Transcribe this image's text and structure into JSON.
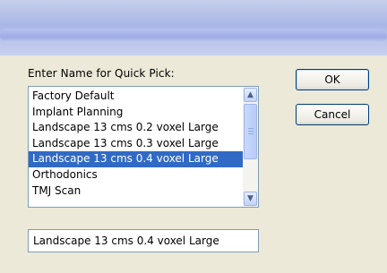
{
  "dialog": {
    "prompt": "Enter Name for Quick Pick:"
  },
  "list": {
    "items": [
      {
        "label": "Factory Default",
        "selected": false
      },
      {
        "label": "Implant Planning",
        "selected": false
      },
      {
        "label": "Landscape 13 cms 0.2 voxel Large",
        "selected": false
      },
      {
        "label": "Landscape 13 cms 0.3 voxel Large",
        "selected": false
      },
      {
        "label": "Landscape 13 cms 0.4 voxel Large",
        "selected": true
      },
      {
        "label": "Orthodonics",
        "selected": false
      },
      {
        "label": "TMJ Scan",
        "selected": false
      }
    ]
  },
  "name_field": {
    "value": "Landscape 13 cms 0.4 voxel Large"
  },
  "buttons": {
    "ok_label": "OK",
    "cancel_label": "Cancel"
  },
  "icons": {
    "scroll_up": "chevron-up-icon",
    "scroll_down": "chevron-down-icon"
  },
  "colors": {
    "selection": "#316ac5",
    "dialog_bg": "#ece9d8",
    "button_border": "#003c74"
  }
}
